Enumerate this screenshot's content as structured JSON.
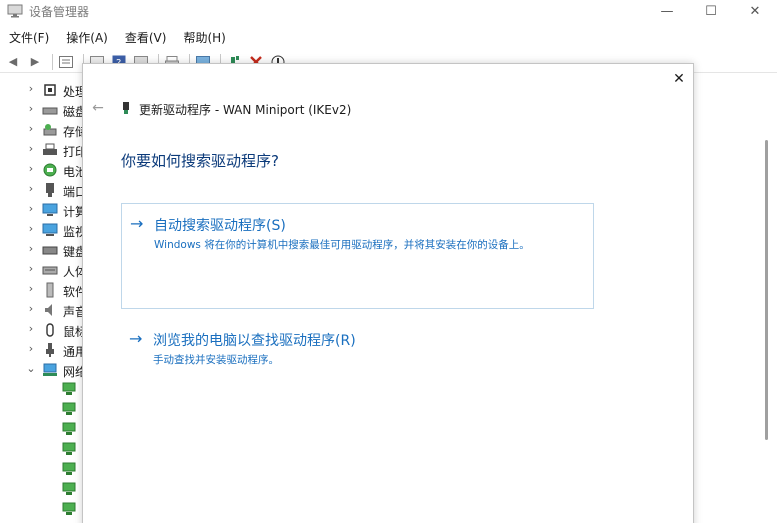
{
  "window": {
    "title": "设备管理器",
    "controls": {
      "minimize": "—",
      "maximize": "☐",
      "close": "✕"
    }
  },
  "menu": {
    "items": [
      "文件(F)",
      "操作(A)",
      "查看(V)",
      "帮助(H)"
    ]
  },
  "toolbar": {
    "back": "◀",
    "forward": "▶"
  },
  "tree": {
    "items": [
      {
        "label": "处理",
        "expanded": false,
        "icon": "processor-icon"
      },
      {
        "label": "磁盘",
        "expanded": false,
        "icon": "disk-icon"
      },
      {
        "label": "存储",
        "expanded": false,
        "icon": "storage-icon"
      },
      {
        "label": "打印",
        "expanded": false,
        "icon": "printer-icon"
      },
      {
        "label": "电池",
        "expanded": false,
        "icon": "battery-icon"
      },
      {
        "label": "端口",
        "expanded": false,
        "icon": "port-icon"
      },
      {
        "label": "计算",
        "expanded": false,
        "icon": "computer-icon"
      },
      {
        "label": "监视",
        "expanded": false,
        "icon": "monitor-icon"
      },
      {
        "label": "键盘",
        "expanded": false,
        "icon": "keyboard-icon"
      },
      {
        "label": "人体",
        "expanded": false,
        "icon": "hid-icon"
      },
      {
        "label": "软件",
        "expanded": false,
        "icon": "software-icon"
      },
      {
        "label": "声音",
        "expanded": false,
        "icon": "speaker-icon"
      },
      {
        "label": "鼠标",
        "expanded": false,
        "icon": "mouse-icon"
      },
      {
        "label": "通用",
        "expanded": false,
        "icon": "usb-icon"
      },
      {
        "label": "网络",
        "expanded": true,
        "icon": "network-icon"
      }
    ]
  },
  "dialog": {
    "close": "✕",
    "back": "←",
    "title": "更新驱动程序 - WAN Miniport (IKEv2)",
    "heading": "你要如何搜索驱动程序?",
    "options": [
      {
        "arrow": "→",
        "title": "自动搜索驱动程序(S)",
        "description": "Windows 将在你的计算机中搜索最佳可用驱动程序，并将其安装在你的设备上。"
      },
      {
        "arrow": "→",
        "title": "浏览我的电脑以查找驱动程序(R)",
        "description": "手动查找并安装驱动程序。"
      }
    ]
  },
  "colors": {
    "link_blue": "#1a6fbf",
    "heading_blue": "#0b3a7a",
    "option_border": "#bfd7ea",
    "delete_red": "#c42b1c",
    "device_green": "#2e8b57"
  }
}
